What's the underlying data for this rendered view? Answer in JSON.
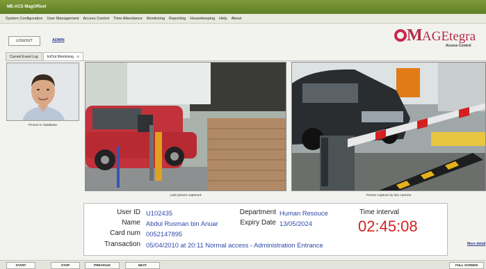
{
  "window": {
    "title": "ME-ACS MagOfficet"
  },
  "menu": [
    "System Configuration",
    "User Management",
    "Access Control",
    "Time Attendance",
    "Monitoring",
    "Reporting",
    "Housekeeping",
    "Help",
    "About"
  ],
  "header": {
    "logout_label": "LOGOUT",
    "user_link": "ADMIN"
  },
  "logo": {
    "brand_initial": "M",
    "brand_rest": "AGEtegra",
    "sub": "Access Control"
  },
  "tabs": [
    {
      "label": "Current Event Log"
    },
    {
      "label": "In/Out Monitoring",
      "close": "⊗"
    }
  ],
  "photo": {
    "caption": "Picture in database"
  },
  "last_picture": {
    "caption": "Last picture captured"
  },
  "live_camera": {
    "caption": "Picture capture by live camera"
  },
  "details": {
    "user_id_label": "User ID",
    "user_id": "U102435",
    "name_label": "Name",
    "name": "Abdul Rusman bin Anuar",
    "card_label": "Card num",
    "card": "0052147895",
    "transaction_label": "Transaction",
    "transaction": "05/04/2010 at 20:11 Normal access - Administration Entrance",
    "department_label": "Department",
    "department": "Human Resouce",
    "expiry_label": "Expiry Date",
    "expiry": "13/05/2024",
    "time_interval_label": "Time interval",
    "time_interval": "02:45:08"
  },
  "more_details": "More detail",
  "buttons": {
    "start": "START",
    "stop": "STOP",
    "previous": "PREVIOUS",
    "next": "NEXT",
    "fullscreen": "FULL SCREEN"
  }
}
